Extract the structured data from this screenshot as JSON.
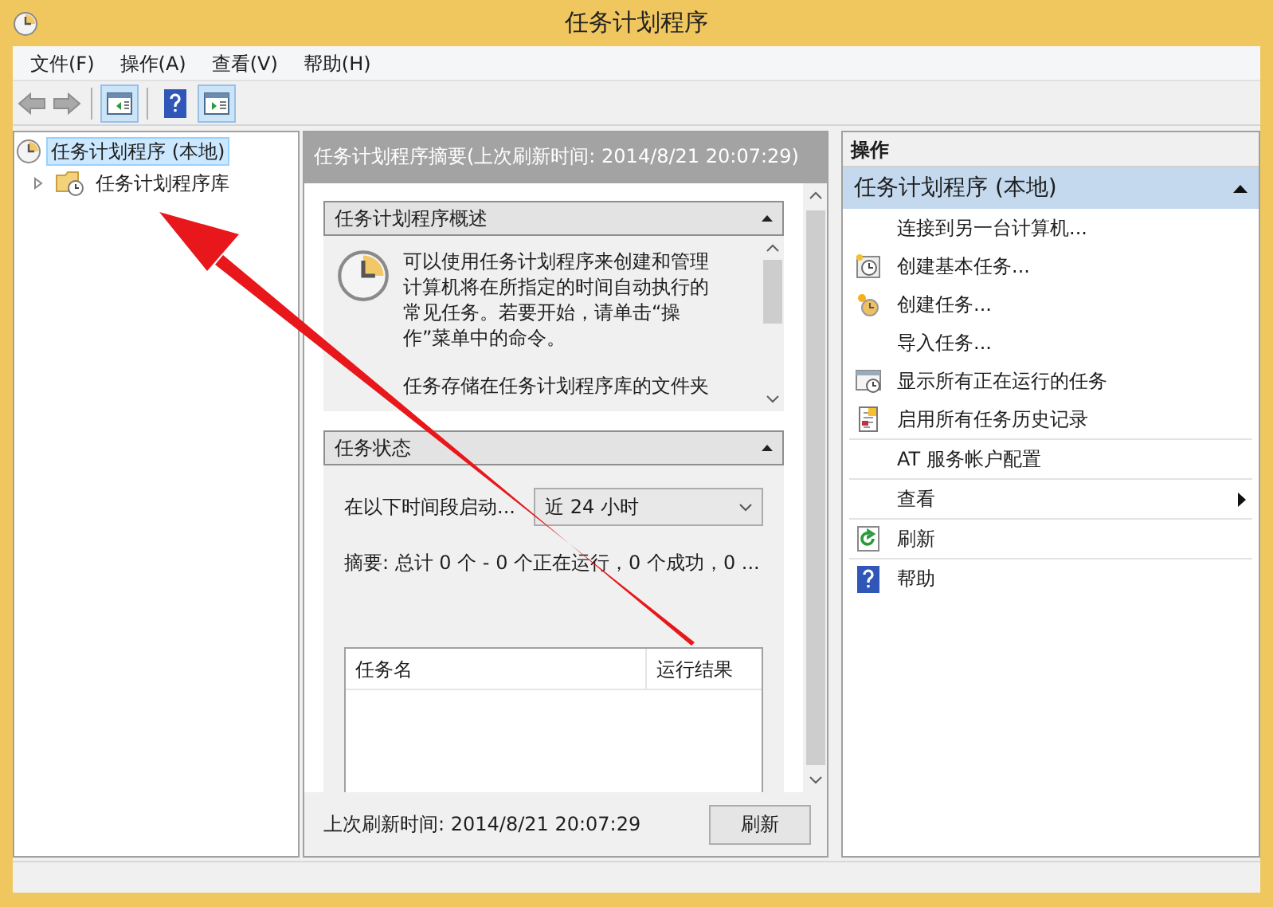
{
  "window": {
    "title": "任务计划程序"
  },
  "menu": [
    "文件(F)",
    "操作(A)",
    "查看(V)",
    "帮助(H)"
  ],
  "toolbar": [
    {
      "kind": "back",
      "disabled": true
    },
    {
      "kind": "forward",
      "disabled": true
    },
    {
      "kind": "tree",
      "selected": true
    },
    {
      "kind": "help",
      "selected": false
    },
    {
      "kind": "actions",
      "selected": true
    }
  ],
  "tree": [
    {
      "label": "任务计划程序 (本地)",
      "selected": true,
      "kind": "clock",
      "children": [
        {
          "label": "任务计划程序库",
          "selected": false,
          "kind": "folder",
          "expanded": false
        }
      ]
    }
  ],
  "summary": {
    "header": "任务计划程序摘要(上次刷新时间: 2014/8/21 20:07:29)",
    "sections": [
      {
        "kind": "overview",
        "title": "任务计划程序概述",
        "expanded": true,
        "paragraphs": [
          "可以使用任务计划程序来创建和管理计算机将在所指定的时间自动执行的常见任务。若要开始，请单击“操作”菜单中的命令。",
          "任务存储在任务计划程序库的文件夹"
        ]
      },
      {
        "kind": "status",
        "title": "任务状态",
        "expanded": true,
        "range_label": "在以下时间段启动...",
        "range_value": "近 24 小时",
        "summary": "摘要: 总计 0 个 - 0 个正在运行，0 个成功，0 ...",
        "columns": [
          "任务名",
          "运行结果"
        ]
      }
    ],
    "footer": "上次刷新时间: 2014/8/21 20:07:29",
    "refresh_button": "刷新"
  },
  "actions": {
    "title": "操作",
    "section": "任务计划程序 (本地)",
    "expanded": true,
    "groups": [
      [
        {
          "label": "连接到另一台计算机...",
          "kind": "plain"
        },
        {
          "label": "创建基本任务...",
          "kind": "wizard"
        },
        {
          "label": "创建任务...",
          "kind": "task"
        },
        {
          "label": "导入任务...",
          "kind": "plain"
        },
        {
          "label": "显示所有正在运行的任务",
          "kind": "running"
        },
        {
          "label": "启用所有任务历史记录",
          "kind": "history"
        }
      ],
      [
        {
          "label": "AT 服务帐户配置",
          "kind": "plain"
        }
      ],
      [
        {
          "label": "查看",
          "kind": "submenu"
        }
      ],
      [
        {
          "label": "刷新",
          "kind": "refresh"
        }
      ],
      [
        {
          "label": "帮助",
          "kind": "help"
        }
      ]
    ]
  }
}
